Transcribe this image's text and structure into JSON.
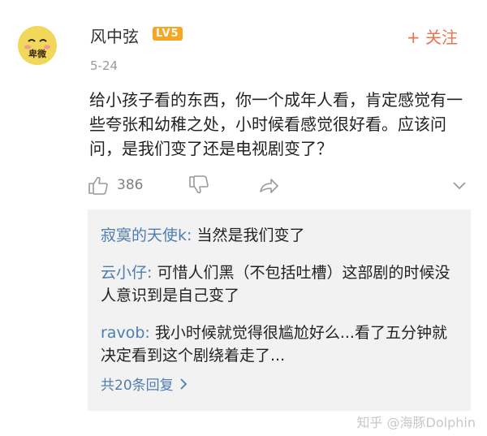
{
  "post": {
    "username": "风中弦",
    "level_badge": "LV5",
    "follow_label": "+ 关注",
    "date": "5-24",
    "avatar_text": "卑微",
    "content": "给小孩子看的东西，你一个成年人看，肯定感觉有一些夸张和幼稚之处，小时候看感觉很好看。应该问问，是我们变了还是电视剧变了？",
    "like_count": "386"
  },
  "replies": {
    "items": [
      {
        "author": "寂寞的天使k:",
        "text": " 当然是我们变了"
      },
      {
        "author": "云小仔:",
        "text": " 可惜人们黑（不包括吐槽）这部剧的时候没人意识到是自己变了"
      },
      {
        "author": "ravob:",
        "text": " 我小时候就觉得很尴尬好么...看了五分钟就决定看到这个剧绕着走了..."
      }
    ],
    "more_label": "共20条回复"
  },
  "watermark": "知乎 @海豚Dolphin",
  "colors": {
    "link": "#507daf",
    "follow": "#eb7350",
    "badge": "#f5a623"
  },
  "icons": [
    "thumbs-up-icon",
    "thumbs-down-icon",
    "share-icon",
    "chevron-down-icon",
    "chevron-right-icon"
  ]
}
